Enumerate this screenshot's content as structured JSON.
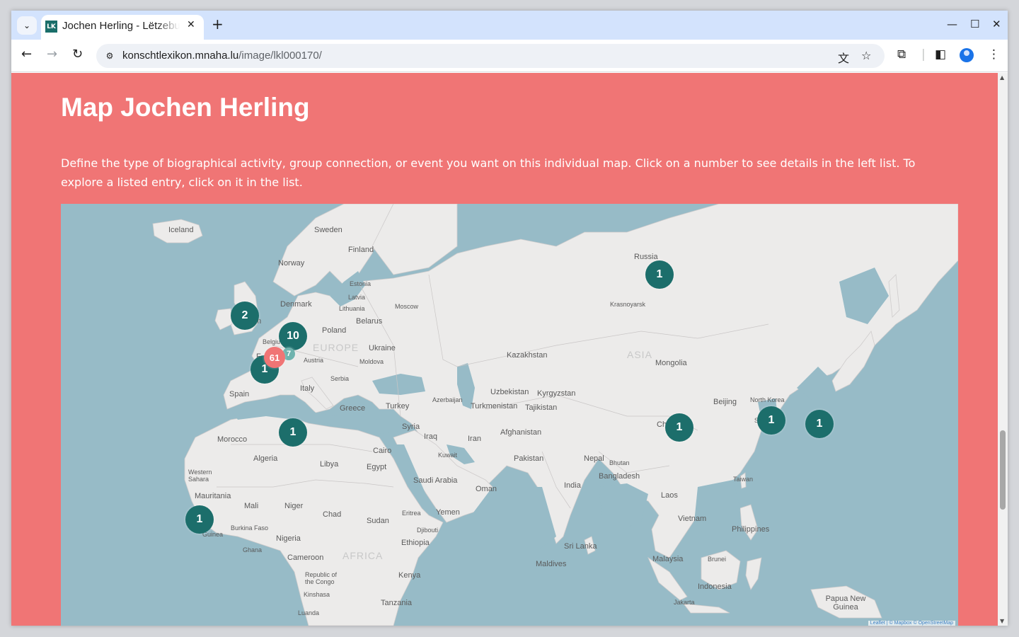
{
  "browser": {
    "tab_title": "Jochen Herling - Lëtzebuerger",
    "favicon_text": "LK",
    "url_host": "konschtlexikon.mnaha.lu",
    "url_path": "/image/lkl000170/"
  },
  "page": {
    "title": "Map Jochen Herling",
    "intro": "Define the type of biographical activity, group connection, or event you want on this individual map. Click on a number to see details in the left list. To explore a listed entry, click on it in the list.",
    "background_color": "#f07575"
  },
  "map": {
    "labels": {
      "iceland": "Iceland",
      "sweden": "Sweden",
      "finland": "Finland",
      "norway": "Norway",
      "russia": "Russia",
      "estonia": "Estonia",
      "latvia": "Latvia",
      "lithuania": "Lithuania",
      "denmark": "Denmark",
      "moscow": "Moscow",
      "krasnoyarsk": "Krasnoyarsk",
      "belarus": "Belarus",
      "poland": "Poland",
      "belgium": "Belgiu",
      "ukraine": "Ukraine",
      "europe": "EUROPE",
      "austria": "Austria",
      "moldova": "Moldova",
      "kazakhstan": "Kazakhstan",
      "asia": "ASIA",
      "mongolia": "Mongolia",
      "serbia": "Serbia",
      "italy": "Italy",
      "spain": "Spain",
      "uzbekistan": "Uzbekistan",
      "kyrgyzstan": "Kyrgyzstan",
      "azerbaijan": "Azerbaijan",
      "turkmenistan": "Turkmenistan",
      "tajikistan": "Tajikistan",
      "beijing": "Beijing",
      "north_korea": "North Korea",
      "greece": "Greece",
      "turkey": "Turkey",
      "syria": "Syria",
      "iraq": "Iraq",
      "iran": "Iran",
      "afghanistan": "Afghanistan",
      "china": "Ch",
      "morocco": "Morocco",
      "cairo": "Cairo",
      "kuwait": "Kuwait",
      "algeria": "Algeria",
      "libya": "Libya",
      "egypt": "Egypt",
      "pakistan": "Pakistan",
      "nepal": "Nepal",
      "bhutan": "Bhutan",
      "western_sahara": "Western Sahara",
      "saudi_arabia": "Saudi Arabia",
      "oman": "Oman",
      "india": "India",
      "bangladesh": "Bangladesh",
      "taiwan": "Taiwan",
      "mauritania": "Mauritania",
      "laos": "Laos",
      "mali": "Mali",
      "niger": "Niger",
      "chad": "Chad",
      "eritrea": "Eritrea",
      "yemen": "Yemen",
      "sudan": "Sudan",
      "burkina_faso": "Burkina Faso",
      "djibouti": "Djibouti",
      "vietnam": "Vietnam",
      "philippines": "Philippines",
      "guinea": "Guinea",
      "nigeria": "Nigeria",
      "ethiopia": "Ethiopia",
      "sri_lanka": "Sri Lanka",
      "ghana": "Ghana",
      "africa": "AFRICA",
      "cameroon": "Cameroon",
      "maldives": "Maldives",
      "malaysia": "Malaysia",
      "brunei": "Brunei",
      "republic_congo": "Republic of the Congo",
      "kenya": "Kenya",
      "indonesia": "Indonesia",
      "kinshasa": "Kinshasa",
      "tanzania": "Tanzania",
      "jakarta": "Jakarta",
      "papua_new_guinea": "Papua New Guinea",
      "luanda": "Luanda",
      "uk": "m",
      "fr": "F",
      "south_korea": "S"
    },
    "markers": [
      {
        "id": "uk",
        "count": "2"
      },
      {
        "id": "benelux",
        "count": "10"
      },
      {
        "id": "luxembourg",
        "count": "61"
      },
      {
        "id": "germany",
        "count": "7"
      },
      {
        "id": "france",
        "count": "1"
      },
      {
        "id": "tunisia",
        "count": "1"
      },
      {
        "id": "russia",
        "count": "1"
      },
      {
        "id": "china",
        "count": "1"
      },
      {
        "id": "korea",
        "count": "1"
      },
      {
        "id": "japan",
        "count": "1"
      },
      {
        "id": "senegal",
        "count": "1"
      }
    ],
    "attribution": "Leaflet | © Mapbox © OpenStreetMap"
  }
}
